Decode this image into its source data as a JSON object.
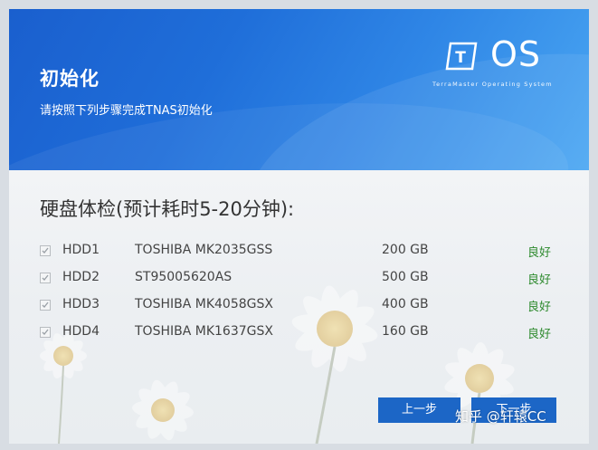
{
  "header": {
    "title": "初始化",
    "subtitle": "请按照下列步骤完成TNAS初始化",
    "logo_letter": "T",
    "logo_text": "OS",
    "logo_tagline": "TerraMaster Operating System"
  },
  "main": {
    "section_title": "硬盘体检(预计耗时5-20分钟):",
    "disks": [
      {
        "name": "HDD1",
        "model": "TOSHIBA MK2035GSS",
        "size": "200 GB",
        "status": "良好",
        "checked": true
      },
      {
        "name": "HDD2",
        "model": "ST95005620AS",
        "size": "500 GB",
        "status": "良好",
        "checked": true
      },
      {
        "name": "HDD3",
        "model": "TOSHIBA MK4058GSX",
        "size": "400 GB",
        "status": "良好",
        "checked": true
      },
      {
        "name": "HDD4",
        "model": "TOSHIBA MK1637GSX",
        "size": "160 GB",
        "status": "良好",
        "checked": true
      }
    ]
  },
  "buttons": {
    "prev_label": "上一步",
    "next_label": "下一步"
  },
  "watermark": "知乎 @轩辕CC",
  "colors": {
    "header_blue": "#1a5fce",
    "button_blue": "#1c66c6",
    "status_green": "#2e8a2e"
  }
}
